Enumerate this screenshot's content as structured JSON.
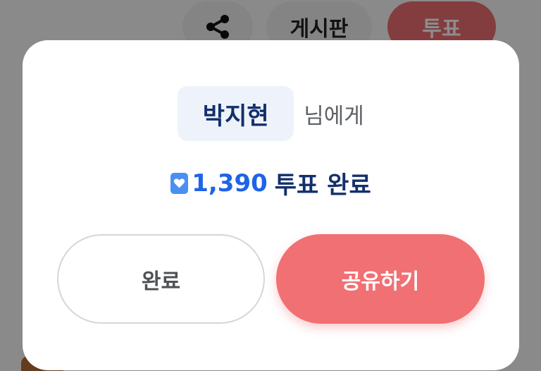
{
  "background": {
    "nav": {
      "share_icon": "share-icon",
      "board_label": "게시판",
      "vote_label": "투표"
    }
  },
  "dialog": {
    "recipient_name": "박지현",
    "recipient_suffix": "님에게",
    "vote_icon": "heart-badge-icon",
    "vote_count": "1,390",
    "vote_text": "투표 완료",
    "done_button_label": "완료",
    "share_button_label": "공유하기"
  },
  "colors": {
    "accent_red": "#f07074",
    "accent_blue": "#1f63e8",
    "navy_text": "#12306b",
    "name_bg": "#eef3fb"
  }
}
